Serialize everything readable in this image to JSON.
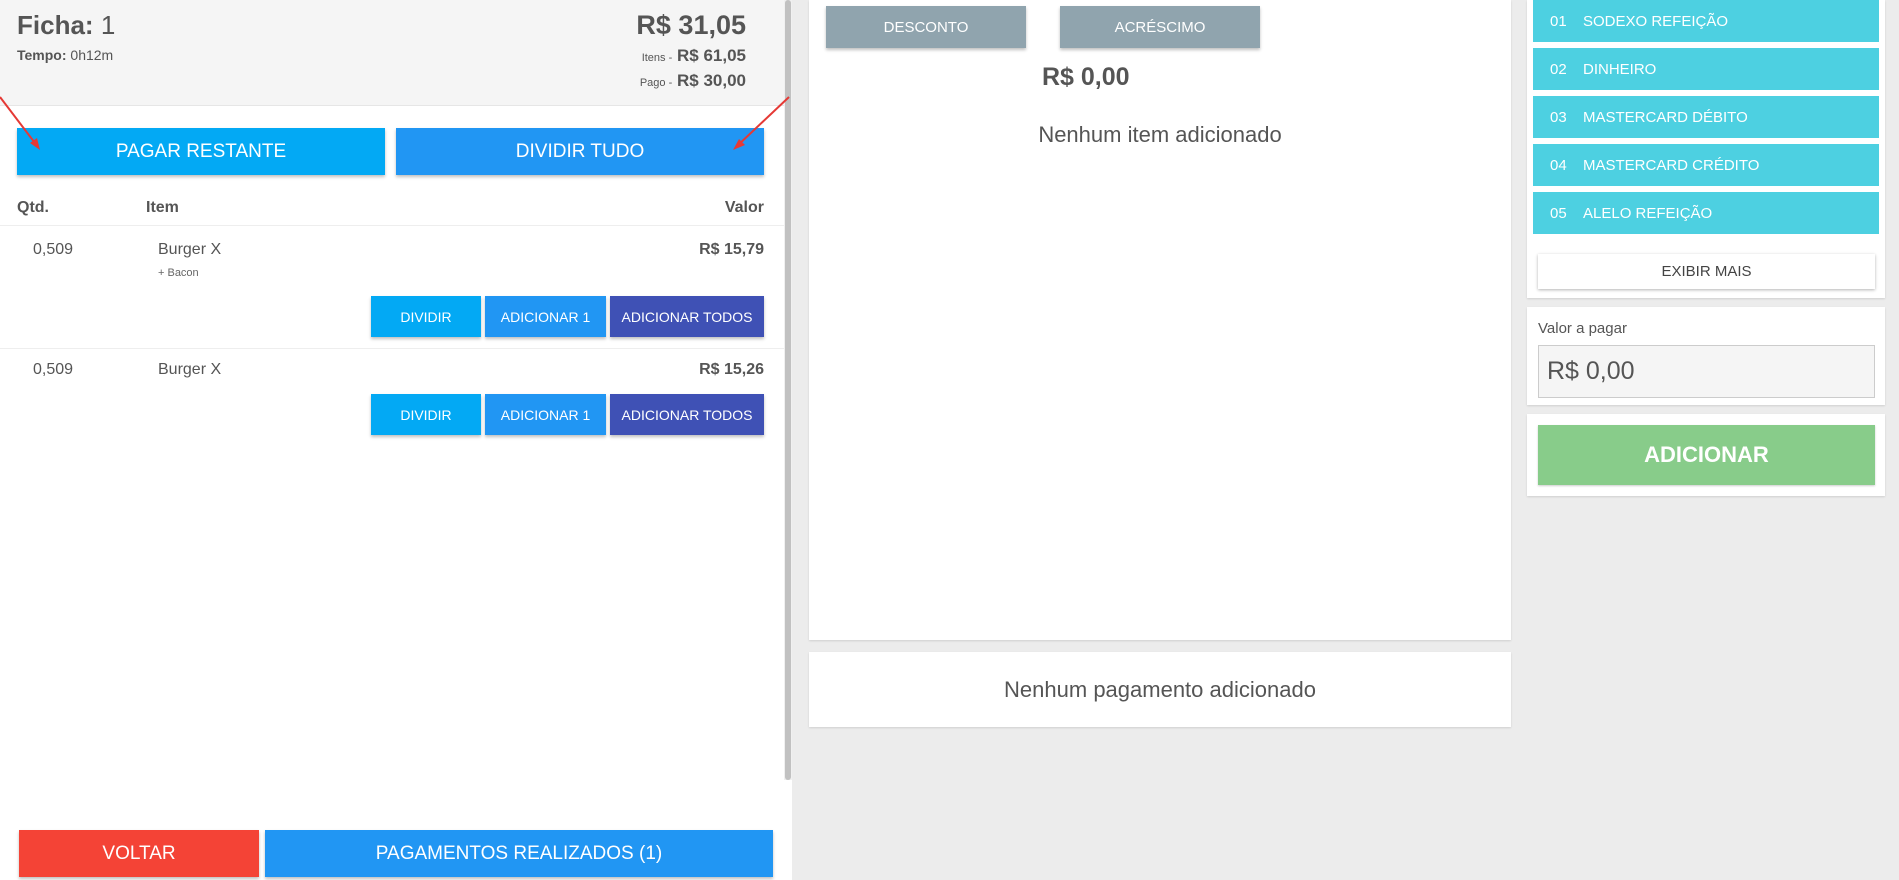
{
  "header": {
    "ficha_label": "Ficha:",
    "ficha_number": "1",
    "tempo_label": "Tempo:",
    "tempo_value": "0h12m",
    "total": "R$ 31,05",
    "itens_label": "Itens -",
    "itens_value": "R$ 61,05",
    "pago_label": "Pago -",
    "pago_value": "R$ 30,00"
  },
  "actions": {
    "pagar_restante": "PAGAR RESTANTE",
    "dividir_tudo": "DIVIDIR TUDO"
  },
  "table": {
    "columns": [
      "Qtd.",
      "Item",
      "Valor"
    ],
    "rows": [
      {
        "qtd": "0,509",
        "item": "Burger X",
        "extra": "+ Bacon",
        "valor": "R$ 15,79"
      },
      {
        "qtd": "0,509",
        "item": "Burger X",
        "extra": "",
        "valor": "R$ 15,26"
      }
    ],
    "row_buttons": {
      "dividir": "DIVIDIR",
      "adicionar_1": "ADICIONAR 1",
      "adicionar_todos": "ADICIONAR TODOS"
    }
  },
  "footer": {
    "voltar": "VOLTAR",
    "pagamentos": "PAGAMENTOS REALIZADOS (1)"
  },
  "middle": {
    "desconto": "DESCONTO",
    "acrescimo": "ACRÉSCIMO",
    "amount": "R$ 0,00",
    "empty_items": "Nenhum item adicionado",
    "empty_payments": "Nenhum pagamento adicionado"
  },
  "payment_methods": [
    {
      "code": "01",
      "label": "SODEXO REFEIÇÃO"
    },
    {
      "code": "02",
      "label": "DINHEIRO"
    },
    {
      "code": "03",
      "label": "MASTERCARD DÉBITO"
    },
    {
      "code": "04",
      "label": "MASTERCARD CRÉDITO"
    },
    {
      "code": "05",
      "label": "ALELO REFEIÇÃO"
    }
  ],
  "right": {
    "exibir_mais": "EXIBIR MAIS",
    "valor_label": "Valor a pagar",
    "valor_value": "R$ 0,00",
    "adicionar": "ADICIONAR"
  },
  "colors": {
    "primary_light": "#03a9f4",
    "primary": "#2196f3",
    "indigo": "#3f51b5",
    "danger": "#f44336",
    "grey_button": "#90a4ae",
    "payment_method": "#4dd0e1",
    "success_disabled": "#88cc8a",
    "annotation_arrow": "#e53935"
  }
}
